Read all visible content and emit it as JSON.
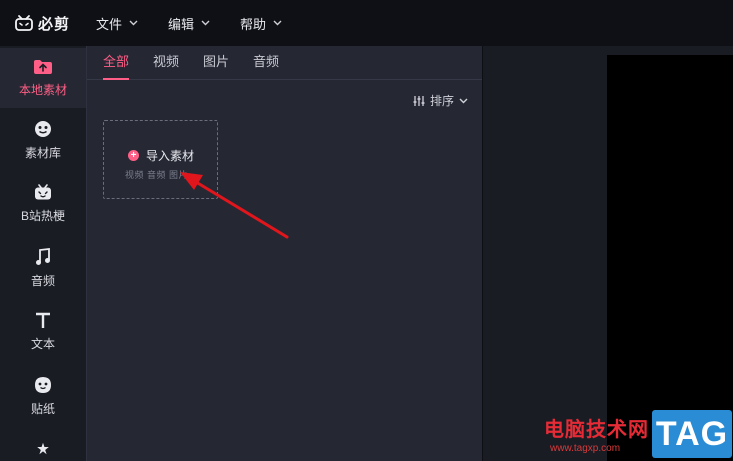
{
  "app": {
    "name": "必剪"
  },
  "menu": [
    {
      "label": "文件"
    },
    {
      "label": "编辑"
    },
    {
      "label": "帮助"
    }
  ],
  "leftnav": [
    {
      "label": "本地素材",
      "icon": "folder-upload-icon",
      "active": true
    },
    {
      "label": "素材库",
      "icon": "emoji-face-icon"
    },
    {
      "label": "B站热梗",
      "icon": "tv-smile-icon"
    },
    {
      "label": "音频",
      "icon": "music-note-icon"
    },
    {
      "label": "文本",
      "icon": "text-t-icon"
    },
    {
      "label": "贴纸",
      "icon": "sticker-face-icon"
    },
    {
      "label": "",
      "icon": "star-icon"
    }
  ],
  "tabs": [
    {
      "label": "全部",
      "active": true
    },
    {
      "label": "视频"
    },
    {
      "label": "图片"
    },
    {
      "label": "音频"
    }
  ],
  "sort": {
    "label": "排序"
  },
  "import": {
    "label": "导入素材",
    "subtitle": "视频 音频 图片"
  },
  "watermark": {
    "site_name": "电脑技术网",
    "url": "www.tagxp.com",
    "tag": "TAG"
  },
  "colors": {
    "accent": "#ff5f86",
    "arrow": "#e0161c",
    "tag_blue": "#2a8cd4"
  }
}
